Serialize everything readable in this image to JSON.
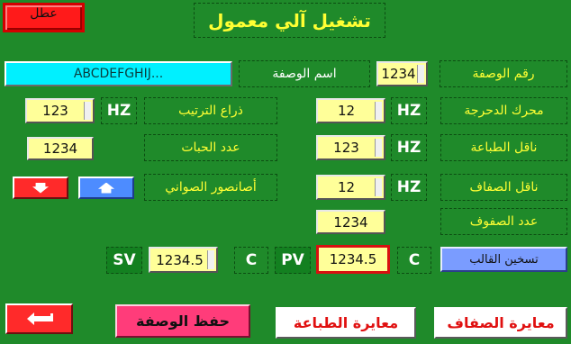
{
  "title": "تشغيل آلي معمول",
  "stop_button": "عطل",
  "recipe": {
    "number_label": "رقم الوصفة",
    "number_value": "1234",
    "name_label": "اسم الوصفة",
    "name_value": "ABCDEFGHIJ..."
  },
  "right_rows": [
    {
      "label": "محرك الدحرجة",
      "unit": "HZ",
      "value": "12"
    },
    {
      "label": "ناقل الطباعة",
      "unit": "HZ",
      "value": "123"
    },
    {
      "label": "ناقل الصفاف",
      "unit": "HZ",
      "value": "12"
    },
    {
      "label": "عدد الصفوف",
      "value": "1234"
    }
  ],
  "left_rows": {
    "arm_label": "ذراع الترتيب",
    "arm_unit": "HZ",
    "arm_value": "123",
    "count_label": "عدد الحبات",
    "count_value": "1234",
    "tray_label": "أصانصور الصواني"
  },
  "temperature": {
    "sv_label": "SV",
    "sv_value": "1234.5",
    "sv_unit": "C",
    "pv_label": "PV",
    "pv_value": "1234.5",
    "pv_unit": "C",
    "heat_button": "تسخين القالب"
  },
  "bottom_buttons": {
    "save": "حفظ الوصفة",
    "print_calib": "معايرة الطباعة",
    "stack_calib": "معايرة الصفاف"
  },
  "colors": {
    "background": "#1f8a2a",
    "label_text": "#ffff33",
    "input_bg": "#ffff99",
    "stop_red": "#ff1a1a",
    "save_pink": "#ff3c7a",
    "heat_blue": "#7a9cff",
    "recipe_name_cyan": "#00f0ff"
  },
  "icons": [
    "back-arrow-icon",
    "arrow-down-icon",
    "arrow-up-icon"
  ]
}
